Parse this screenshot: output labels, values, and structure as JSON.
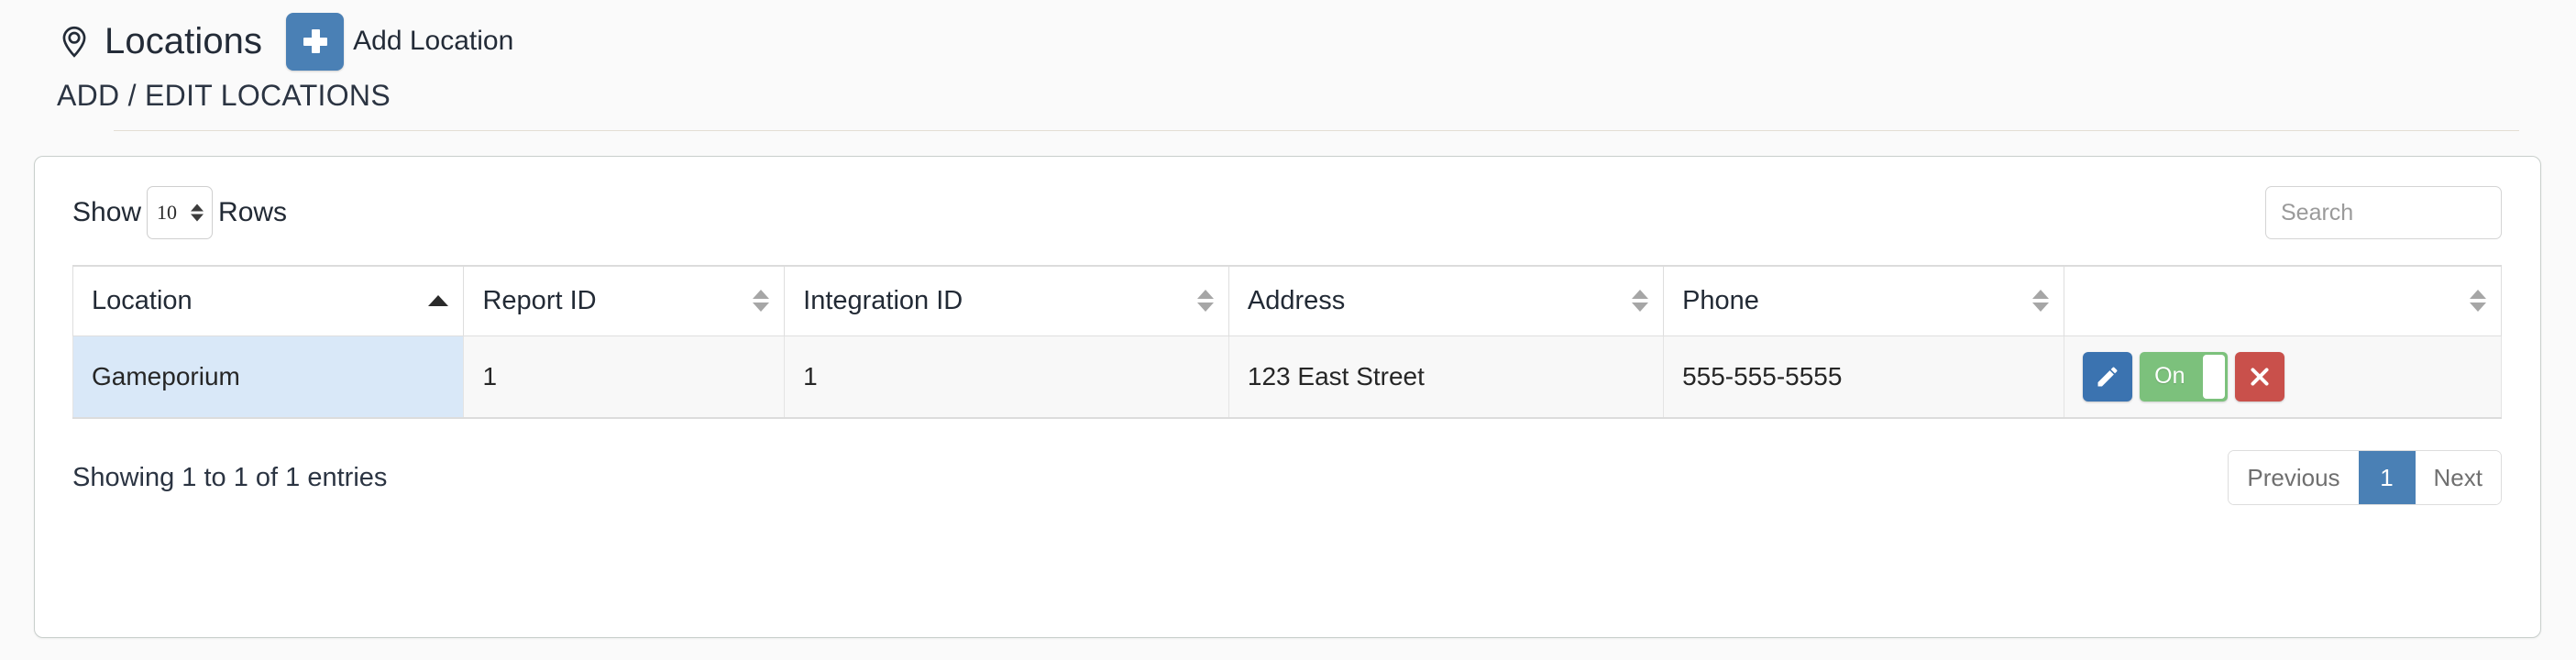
{
  "header": {
    "pin_icon": "map-pin-icon",
    "title": "Locations",
    "add_button_icon": "plus-icon",
    "add_button_label": "Add Location",
    "subtitle": "ADD / EDIT LOCATIONS"
  },
  "controls": {
    "show_label": "Show",
    "rows_value": "10",
    "rows_label": "Rows",
    "search_placeholder": "Search",
    "search_value": ""
  },
  "table": {
    "columns": [
      {
        "label": "Location",
        "sort": "asc"
      },
      {
        "label": "Report ID",
        "sort": "none"
      },
      {
        "label": "Integration ID",
        "sort": "none"
      },
      {
        "label": "Address",
        "sort": "none"
      },
      {
        "label": "Phone",
        "sort": "none"
      },
      {
        "label": "",
        "sort": "none"
      }
    ],
    "rows": [
      {
        "location": "Gameporium",
        "report_id": "1",
        "integration_id": "1",
        "address": "123 East Street",
        "phone": "555-555-5555",
        "actions": {
          "edit_icon": "pencil-icon",
          "toggle_label": "On",
          "toggle_state": "on",
          "delete_icon": "close-x-icon"
        }
      }
    ]
  },
  "footer": {
    "entries_info": "Showing 1 to 1 of 1 entries",
    "previous_label": "Previous",
    "page_1_label": "1",
    "next_label": "Next"
  },
  "colors": {
    "accent_blue": "#4a80b5",
    "toggle_green": "#7cc17c",
    "delete_red": "#c9504b",
    "sorted_cell": "#d9e8f8"
  }
}
